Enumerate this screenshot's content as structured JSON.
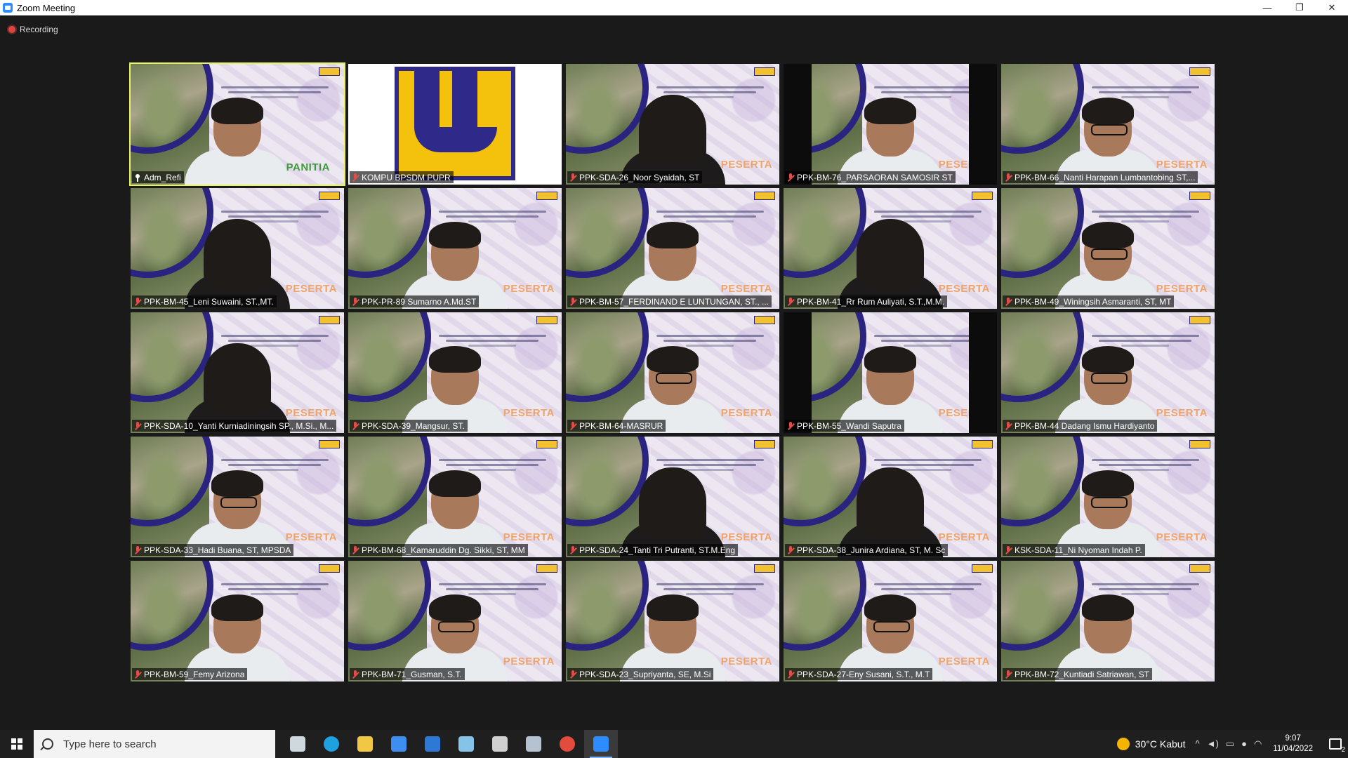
{
  "window": {
    "title": "Zoom Meeting",
    "minimize": "—",
    "restore": "❐",
    "close": "✕"
  },
  "recording": {
    "label": "Recording"
  },
  "tiles": [
    {
      "name": "Adm_Refi",
      "type": "panitia",
      "active": true,
      "pinned": true,
      "overlay": "PANITIA"
    },
    {
      "name": "KOMPU BPSDM PUPR",
      "type": "logo"
    },
    {
      "name": "PPK-SDA-26_Noor Syaidah, ST",
      "type": "peserta",
      "style": "hijab glasses"
    },
    {
      "name": "PPK-BM-76_PARSAORAN SAMOSIR ST",
      "type": "peserta",
      "style": "bars"
    },
    {
      "name": "PPK-BM-66_Nanti Harapan Lumbantobing ST,...",
      "type": "peserta",
      "style": "glasses"
    },
    {
      "name": "PPK-BM-45_Leni Suwaini, ST.,MT.",
      "type": "peserta",
      "style": "hijab glasses"
    },
    {
      "name": "PPK-PR-89 Sumarno A.Md.ST",
      "type": "peserta",
      "style": ""
    },
    {
      "name": "PPK-BM-57_FERDINAND E LUNTUNGAN, ST., ...",
      "type": "peserta",
      "style": ""
    },
    {
      "name": "PPK-BM-41_Rr Rum Auliyati, S.T.,M.M.",
      "type": "peserta",
      "style": "hijab"
    },
    {
      "name": "PPK-BM-49_Winingsih Asmaranti, ST, MT",
      "type": "peserta",
      "style": "glasses"
    },
    {
      "name": "PPK-SDA-10_Yanti Kurniadiningsih SP., M.Si., M...",
      "type": "peserta",
      "style": "hijab"
    },
    {
      "name": "PPK-SDA-39_Mangsur, ST.",
      "type": "peserta",
      "style": ""
    },
    {
      "name": "PPK-BM-64-MASRUR",
      "type": "peserta",
      "style": "glasses"
    },
    {
      "name": "PPK-BM-55_Wandi Saputra",
      "type": "peserta",
      "style": "bars"
    },
    {
      "name": "PPK-BM-44 Dadang Ismu Hardiyanto",
      "type": "peserta",
      "style": "glasses"
    },
    {
      "name": "PPK-SDA-33_Hadi Buana, ST, MPSDA",
      "type": "peserta",
      "style": "glasses"
    },
    {
      "name": "PPK-BM-68_Kamaruddin Dg. Sikki, ST, MM",
      "type": "peserta",
      "style": ""
    },
    {
      "name": "PPK-SDA-24_Tanti Tri Putranti, ST.M.Eng",
      "type": "peserta",
      "style": "hijab glasses"
    },
    {
      "name": "PPK-SDA-38_Junira Ardiana, ST, M. Sc",
      "type": "peserta",
      "style": "hijab"
    },
    {
      "name": "KSK-SDA-11_Ni Nyoman Indah P.",
      "type": "peserta",
      "style": "glasses"
    },
    {
      "name": "PPK-BM-59_Femy Arizona",
      "type": "plain",
      "style": ""
    },
    {
      "name": "PPK-BM-71_Gusman, S.T.",
      "type": "peserta",
      "style": "glasses"
    },
    {
      "name": "PPK-SDA-23_Supriyanta, SE, M.Si",
      "type": "peserta",
      "style": ""
    },
    {
      "name": "PPK-SDA-27-Eny Susani, S.T., M.T",
      "type": "peserta",
      "style": "glasses"
    },
    {
      "name": "PPK-BM-72_Kuntiadi Satriawan, ST",
      "type": "plain",
      "style": ""
    }
  ],
  "peserta_label": "PESERTA",
  "taskbar": {
    "search_placeholder": "Type here to search",
    "apps": [
      {
        "icon": "task-view-icon",
        "color": "#cfd8dc"
      },
      {
        "icon": "edge-icon",
        "color": "#1fa0e0"
      },
      {
        "icon": "file-explorer-icon",
        "color": "#f2c744"
      },
      {
        "icon": "store-icon",
        "color": "#3d8ef0"
      },
      {
        "icon": "mail-icon",
        "color": "#2f79d6"
      },
      {
        "icon": "notes-icon",
        "color": "#86c3e8"
      },
      {
        "icon": "settings-icon",
        "color": "#d0d0d0"
      },
      {
        "icon": "photos-icon",
        "color": "#b6c2cf"
      },
      {
        "icon": "chrome-icon",
        "color": "#e34b3c"
      },
      {
        "icon": "zoom-icon",
        "color": "#2d8cff"
      }
    ],
    "weather": "30°C  Kabut",
    "time": "9:07",
    "date": "11/04/2022",
    "notifications": "2"
  }
}
